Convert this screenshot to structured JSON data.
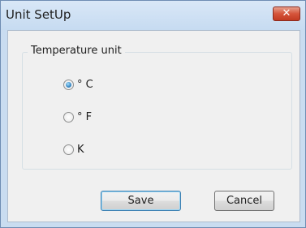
{
  "window": {
    "title": "Unit SetUp",
    "close_label": "✕"
  },
  "group": {
    "legend": "Temperature unit",
    "options": [
      {
        "label": "° C",
        "selected": true
      },
      {
        "label": "° F",
        "selected": false
      },
      {
        "label": "K",
        "selected": false
      }
    ]
  },
  "buttons": {
    "save_label": "Save",
    "cancel_label": "Cancel"
  },
  "colors": {
    "frame": "#c9dcf0",
    "close_button": "#c23b22",
    "default_button_border": "#3c7fb1"
  }
}
